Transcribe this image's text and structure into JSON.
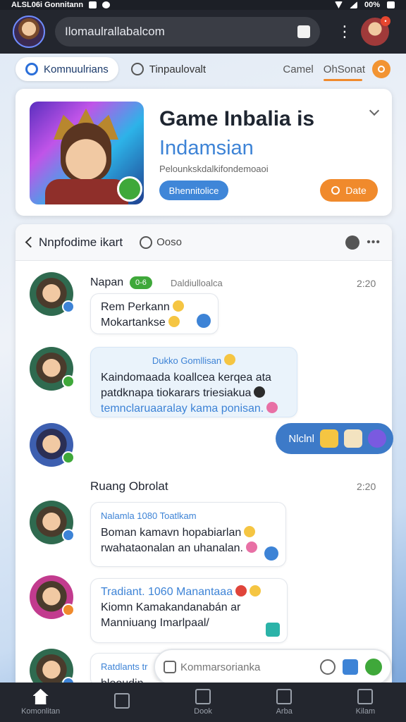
{
  "status_bar": {
    "left_text": "ALSL06i Gonnitann",
    "battery": "00%"
  },
  "app_bar": {
    "url": "Ilomaulrallabalcom"
  },
  "filters": {
    "chip_active": "Komnuulrians",
    "chip_secondary": "Tinpaulovalt",
    "link_camel": "Camel",
    "link_active": "OhSonat"
  },
  "game": {
    "title": "Game Inbalia is",
    "subtitle": "Indamsian",
    "description": "Pelounkskdalkifondemoaoi",
    "primary_button": "Bhennitolice",
    "secondary_button": "Date"
  },
  "chat": {
    "title": "Nnpfodime ikart",
    "secondary_tab": "Ooso",
    "messages": [
      {
        "sender": "Napan",
        "tag": "0-6",
        "sub": "Daldiulloalca",
        "time": "2:20",
        "lines": [
          "Rem Perkann",
          "Mokartankse"
        ]
      },
      {
        "header": "Dukko Gomllisan",
        "lines": [
          "Kaindomaada koallcea kerqea ata",
          "patdknapa tiokarars triesiakua",
          "temnclaruaaralay kama ponisan."
        ]
      },
      {
        "outgoing_text": "Nlclnl"
      },
      {
        "section": "Ruang Obrolat",
        "time": "2:20",
        "header": "Nalamla 1080 Toatlkam",
        "lines": [
          "Boman kamavn hopabiarlan",
          "rwahataonalan an uhanalan."
        ]
      },
      {
        "header": "Tradiant. 1060 Manantaaa",
        "lines": [
          "Kiomn Kamakandanabán ar",
          "Manniuang Imarlpaal/"
        ]
      },
      {
        "header": "Ratdlants tr",
        "lines": [
          "blooudin"
        ]
      }
    ]
  },
  "composer": {
    "placeholder": "Kommarsorianka"
  },
  "bottom_nav": [
    {
      "label": "Komonlitan",
      "icon": "home-icon"
    },
    {
      "label": "",
      "icon": "store-icon"
    },
    {
      "label": "Dook",
      "icon": "edit-icon"
    },
    {
      "label": "Arba",
      "icon": "check-box-icon"
    },
    {
      "label": "Kilam",
      "icon": "minus-box-icon"
    }
  ],
  "colors": {
    "accent": "#3d83d6",
    "orange": "#f08a2c",
    "green": "#3fa83a",
    "dark": "#23262e"
  }
}
